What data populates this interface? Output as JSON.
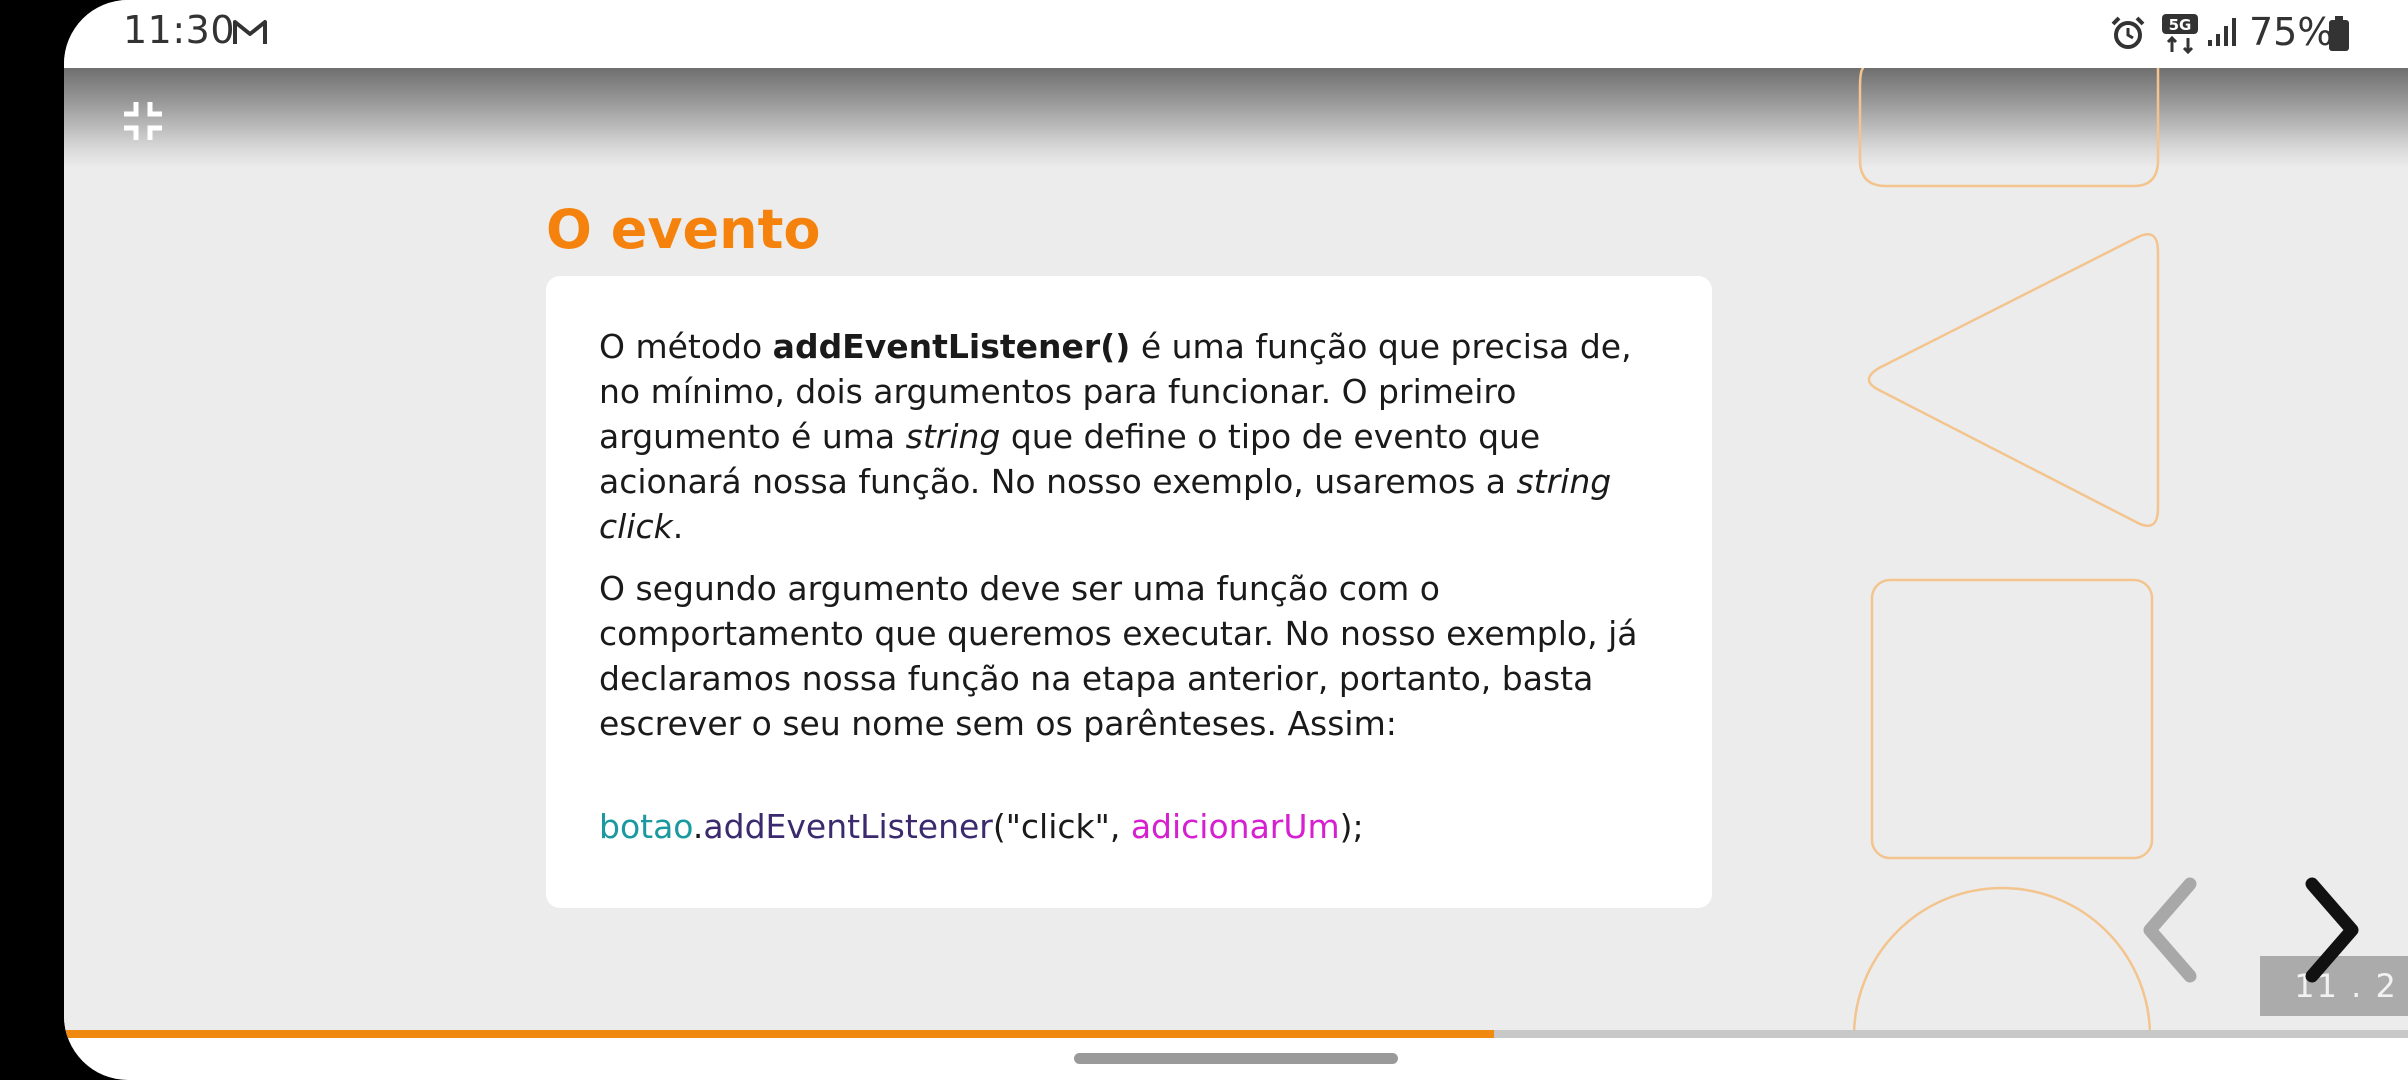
{
  "status_bar": {
    "time": "11:30",
    "battery": "75%",
    "network": "5G"
  },
  "slide": {
    "title": "O evento",
    "paragraph1": {
      "t1": "O método ",
      "bold": "addEventListener()",
      "t2": " é uma função que precisa de, no mínimo, dois argumentos para funcionar. O primeiro argumento é uma ",
      "italic1": "string",
      "t3": " que define o tipo de evento que acionará nossa função. No nosso exemplo, usaremos a ",
      "italic2": "string click",
      "t4": "."
    },
    "paragraph2": "O segundo argumento deve ser uma função com o comportamento que queremos executar. No nosso exemplo, já declaramos nossa função na etapa anterior, portanto, basta escrever o seu nome sem os parênteses. Assim:",
    "code": {
      "object": "botao",
      "dot": ".",
      "method": "addEventListener",
      "args_open": "(\"click\", ",
      "fn": "adicionarUm",
      "args_close": ");"
    }
  },
  "navigation": {
    "slide_number": "11 . 2",
    "progress_percent": 61
  },
  "colors": {
    "accent": "#f5820d",
    "code_object": "#1a9aa0",
    "code_method": "#3b2a6e",
    "code_function": "#d51fd0"
  },
  "icons": [
    "gmail-icon",
    "alarm-icon",
    "5g-icon",
    "signal-icon",
    "battery-icon",
    "exit-fullscreen-icon",
    "chevron-left-icon",
    "chevron-right-icon"
  ]
}
